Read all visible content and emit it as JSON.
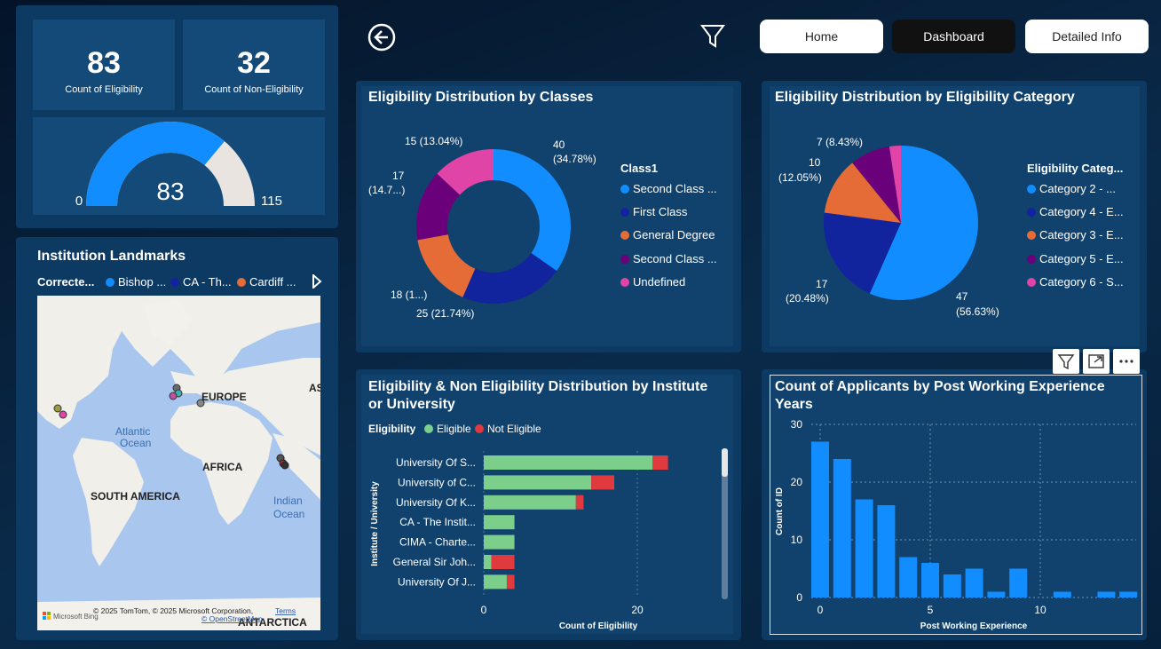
{
  "kpis": {
    "eligible": {
      "value": "83",
      "label": "Count of Eligibility"
    },
    "non_eligible": {
      "value": "32",
      "label": "Count of Non-Eligibility"
    }
  },
  "gauge": {
    "value": "83",
    "min": "0",
    "max": "115",
    "fraction": 0.7217
  },
  "nav": {
    "home": "Home",
    "dashboard": "Dashboard",
    "detailed": "Detailed Info"
  },
  "icons": {
    "back": "back-arrow-icon",
    "filter": "filter-icon"
  },
  "map": {
    "title": "Institution Landmarks",
    "legend_title": "Correcte...",
    "legend": [
      {
        "label": "Bishop ...",
        "color": "#118dff"
      },
      {
        "label": "CA - Th...",
        "color": "#12239e"
      },
      {
        "label": "Cardiff ...",
        "color": "#e66c37"
      }
    ],
    "labels": {
      "europe": "EUROPE",
      "asia": "AS",
      "atlantic1": "Atlantic",
      "atlantic2": "Ocean",
      "africa": "AFRICA",
      "south_america": "SOUTH AMERICA",
      "indian1": "Indian",
      "indian2": "Ocean",
      "antarctica": "ANTARCTICA"
    },
    "attribution": "© 2025 TomTom, © 2025 Microsoft Corporation,",
    "terms": "Terms",
    "osm": "© OpenStreetMap",
    "bing": "Microsoft Bing"
  },
  "classes_chart": {
    "title": "Eligibility Distribution by Classes",
    "legend_title": "Class1",
    "legend": [
      {
        "label": "Second Class ...",
        "color": "#118dff"
      },
      {
        "label": "First Class",
        "color": "#12239e"
      },
      {
        "label": "General Degree",
        "color": "#e66c37"
      },
      {
        "label": "Second Class ...",
        "color": "#6b007b"
      },
      {
        "label": "Undefined",
        "color": "#e044a7"
      }
    ],
    "data_labels": [
      "40",
      "(34.78%)",
      "25 (21.74%)",
      "18 (1...)",
      "17",
      "(14.7...)",
      "15 (13.04%)"
    ]
  },
  "category_chart": {
    "title": "Eligibility Distribution by Eligibility Category",
    "legend_title": "Eligibility Categ...",
    "legend": [
      {
        "label": "Category 2 - ...",
        "color": "#118dff"
      },
      {
        "label": "Category 4 - E...",
        "color": "#12239e"
      },
      {
        "label": "Category 3 - E...",
        "color": "#e66c37"
      },
      {
        "label": "Category 5 - E...",
        "color": "#6b007b"
      },
      {
        "label": "Category 6 - S...",
        "color": "#e044a7"
      }
    ],
    "data_labels": [
      "47",
      "(56.63%)",
      "17",
      "(20.48%)",
      "10",
      "(12.05%)",
      "7 (8.43%)"
    ]
  },
  "institute_chart": {
    "title1": "Eligibility & Non Eligibility Distribution by Institute",
    "title2": "or University",
    "legend_title": "Eligibility",
    "legend": [
      {
        "label": "Eligible",
        "color": "#7ccf8a"
      },
      {
        "label": "Not Eligible",
        "color": "#e03a3e"
      }
    ],
    "ylabel": "Institute / University",
    "xlabel": "Count of Eligibility",
    "ticks": [
      "0",
      "20"
    ]
  },
  "experience_chart": {
    "title1": "Count of Applicants by Post Working Experience",
    "title2": "Years",
    "ylabel": "Count of ID",
    "xlabel": "Post Working Experience",
    "yticks": [
      "0",
      "10",
      "20",
      "30"
    ],
    "xticks": [
      "0",
      "5",
      "10"
    ]
  },
  "chart_data": [
    {
      "type": "pie",
      "title": "Eligibility Distribution by Classes",
      "categories": [
        "Second Class ...",
        "First Class",
        "General Degree",
        "Second Class ...",
        "Undefined"
      ],
      "values": [
        40,
        25,
        18,
        17,
        15
      ],
      "colors": [
        "#118dff",
        "#12239e",
        "#e66c37",
        "#6b007b",
        "#e044a7"
      ],
      "donut": true
    },
    {
      "type": "pie",
      "title": "Eligibility Distribution by Eligibility Category",
      "categories": [
        "Category 2 - ...",
        "Category 4 - E...",
        "Category 3 - E...",
        "Category 5 - E...",
        "Category 6 - S..."
      ],
      "values": [
        47,
        17,
        10,
        7,
        2
      ],
      "colors": [
        "#118dff",
        "#12239e",
        "#e66c37",
        "#6b007b",
        "#e044a7"
      ]
    },
    {
      "type": "bar",
      "orientation": "horizontal",
      "stacked": true,
      "title": "Eligibility & Non Eligibility Distribution by Institute or University",
      "categories": [
        "University Of S...",
        "University of C...",
        "University Of K...",
        "CA - The Instit...",
        "CIMA - Charte...",
        "General Sir Joh...",
        "University Of J..."
      ],
      "series": [
        {
          "name": "Eligible",
          "values": [
            22,
            14,
            12,
            4,
            4,
            1,
            3
          ]
        },
        {
          "name": "Not Eligible",
          "values": [
            2,
            3,
            1,
            0,
            0,
            3,
            1
          ]
        }
      ],
      "xlabel": "Count of Eligibility",
      "ylabel": "Institute / University",
      "xlim": [
        0,
        30
      ]
    },
    {
      "type": "bar",
      "title": "Count of Applicants by Post Working Experience Years",
      "x": [
        0,
        1,
        2,
        3,
        4,
        5,
        6,
        7,
        8,
        9,
        11,
        13,
        14
      ],
      "values": [
        27,
        24,
        17,
        16,
        7,
        6,
        4,
        5,
        1,
        5,
        1,
        1,
        1
      ],
      "xlabel": "Post Working Experience",
      "ylabel": "Count of ID",
      "ylim": [
        0,
        30
      ]
    }
  ]
}
